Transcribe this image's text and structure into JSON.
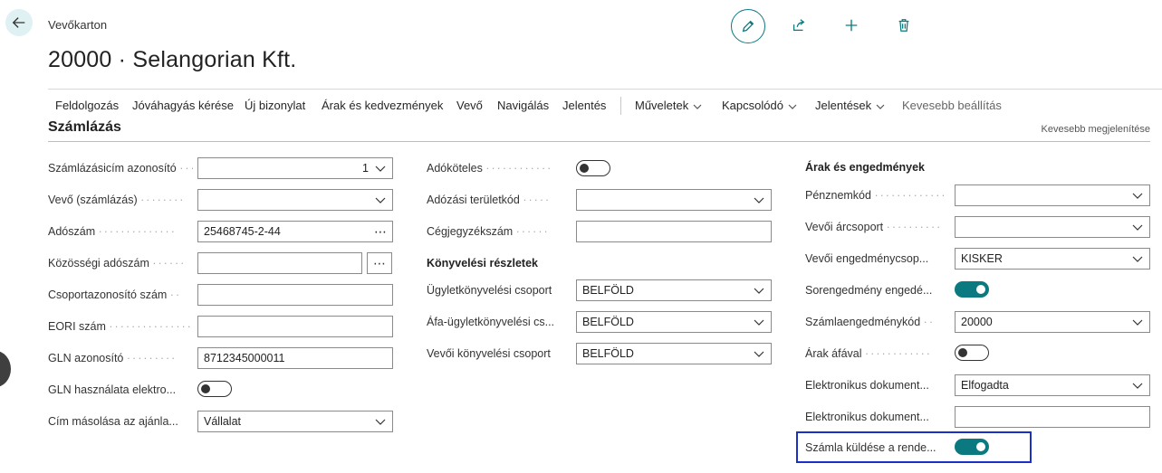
{
  "breadcrumb": "Vevőkarton",
  "page_title": "20000 · Selangorian Kft.",
  "icons": {
    "back": "arrow-left-icon",
    "edit": "pencil-icon",
    "share": "share-icon",
    "new": "plus-icon",
    "delete": "trash-icon"
  },
  "colors": {
    "accent": "#0b7a80",
    "highlight_border": "#1a30c7"
  },
  "actionbar": {
    "items": [
      "Feldolgozás",
      "Jóváhagyás kérése",
      "Új bizonylat",
      "Árak és kedvezmények",
      "Vevő",
      "Navigálás",
      "Jelentés"
    ],
    "menus": [
      "Műveletek",
      "Kapcsolódó",
      "Jelentések"
    ],
    "less_options": "Kevesebb beállítás"
  },
  "section": {
    "title": "Számlázás",
    "show_less": "Kevesebb megjelenítése"
  },
  "col1": {
    "billing_address_id": {
      "label": "Számlázásicím azonosító",
      "value": "1"
    },
    "bill_to_customer": {
      "label": "Vevő (számlázás)",
      "value": ""
    },
    "vat_reg_no": {
      "label": "Adószám",
      "value": "25468745-2-44"
    },
    "eu_vat_no": {
      "label": "Közösségi adószám",
      "value": ""
    },
    "group_id": {
      "label": "Csoportazonosító szám",
      "value": ""
    },
    "eori": {
      "label": "EORI szám",
      "value": ""
    },
    "gln": {
      "label": "GLN azonosító",
      "value": "8712345000011"
    },
    "use_gln": {
      "label": "GLN használata elektro...",
      "checked": false
    },
    "copy_address": {
      "label": "Cím másolása az ajánla...",
      "value": "Vállalat"
    }
  },
  "col2": {
    "taxable": {
      "label": "Adóköteles",
      "checked": false
    },
    "tax_area": {
      "label": "Adózási területkód",
      "value": ""
    },
    "company_reg_no": {
      "label": "Cégjegyzékszám",
      "value": ""
    },
    "posting_group_title": "Könyvelési részletek",
    "gen_bus_posting": {
      "label": "Ügyletkönyvelési csoport",
      "value": "BELFÖLD"
    },
    "vat_bus_posting": {
      "label": "Áfa-ügyletkönyvelési cs...",
      "value": "BELFÖLD"
    },
    "customer_posting": {
      "label": "Vevői könyvelési csoport",
      "value": "BELFÖLD"
    }
  },
  "col3": {
    "group_title": "Árak és engedmények",
    "currency": {
      "label": "Pénznemkód",
      "value": ""
    },
    "price_group": {
      "label": "Vevői árcsoport",
      "value": ""
    },
    "disc_group": {
      "label": "Vevői engedménycsop...",
      "value": "KISKER"
    },
    "line_discount": {
      "label": "Sorengedmény engedé...",
      "checked": true
    },
    "invoice_disc_code": {
      "label": "Számlaengedménykód",
      "value": "20000"
    },
    "prices_incl_vat": {
      "label": "Árak áfával",
      "checked": false
    },
    "edoc_1": {
      "label": "Elektronikus dokument...",
      "value": "Elfogadta"
    },
    "edoc_2": {
      "label": "Elektronikus dokument...",
      "value": ""
    },
    "send_invoice": {
      "label": "Számla küldése a rende...",
      "checked": true
    }
  }
}
